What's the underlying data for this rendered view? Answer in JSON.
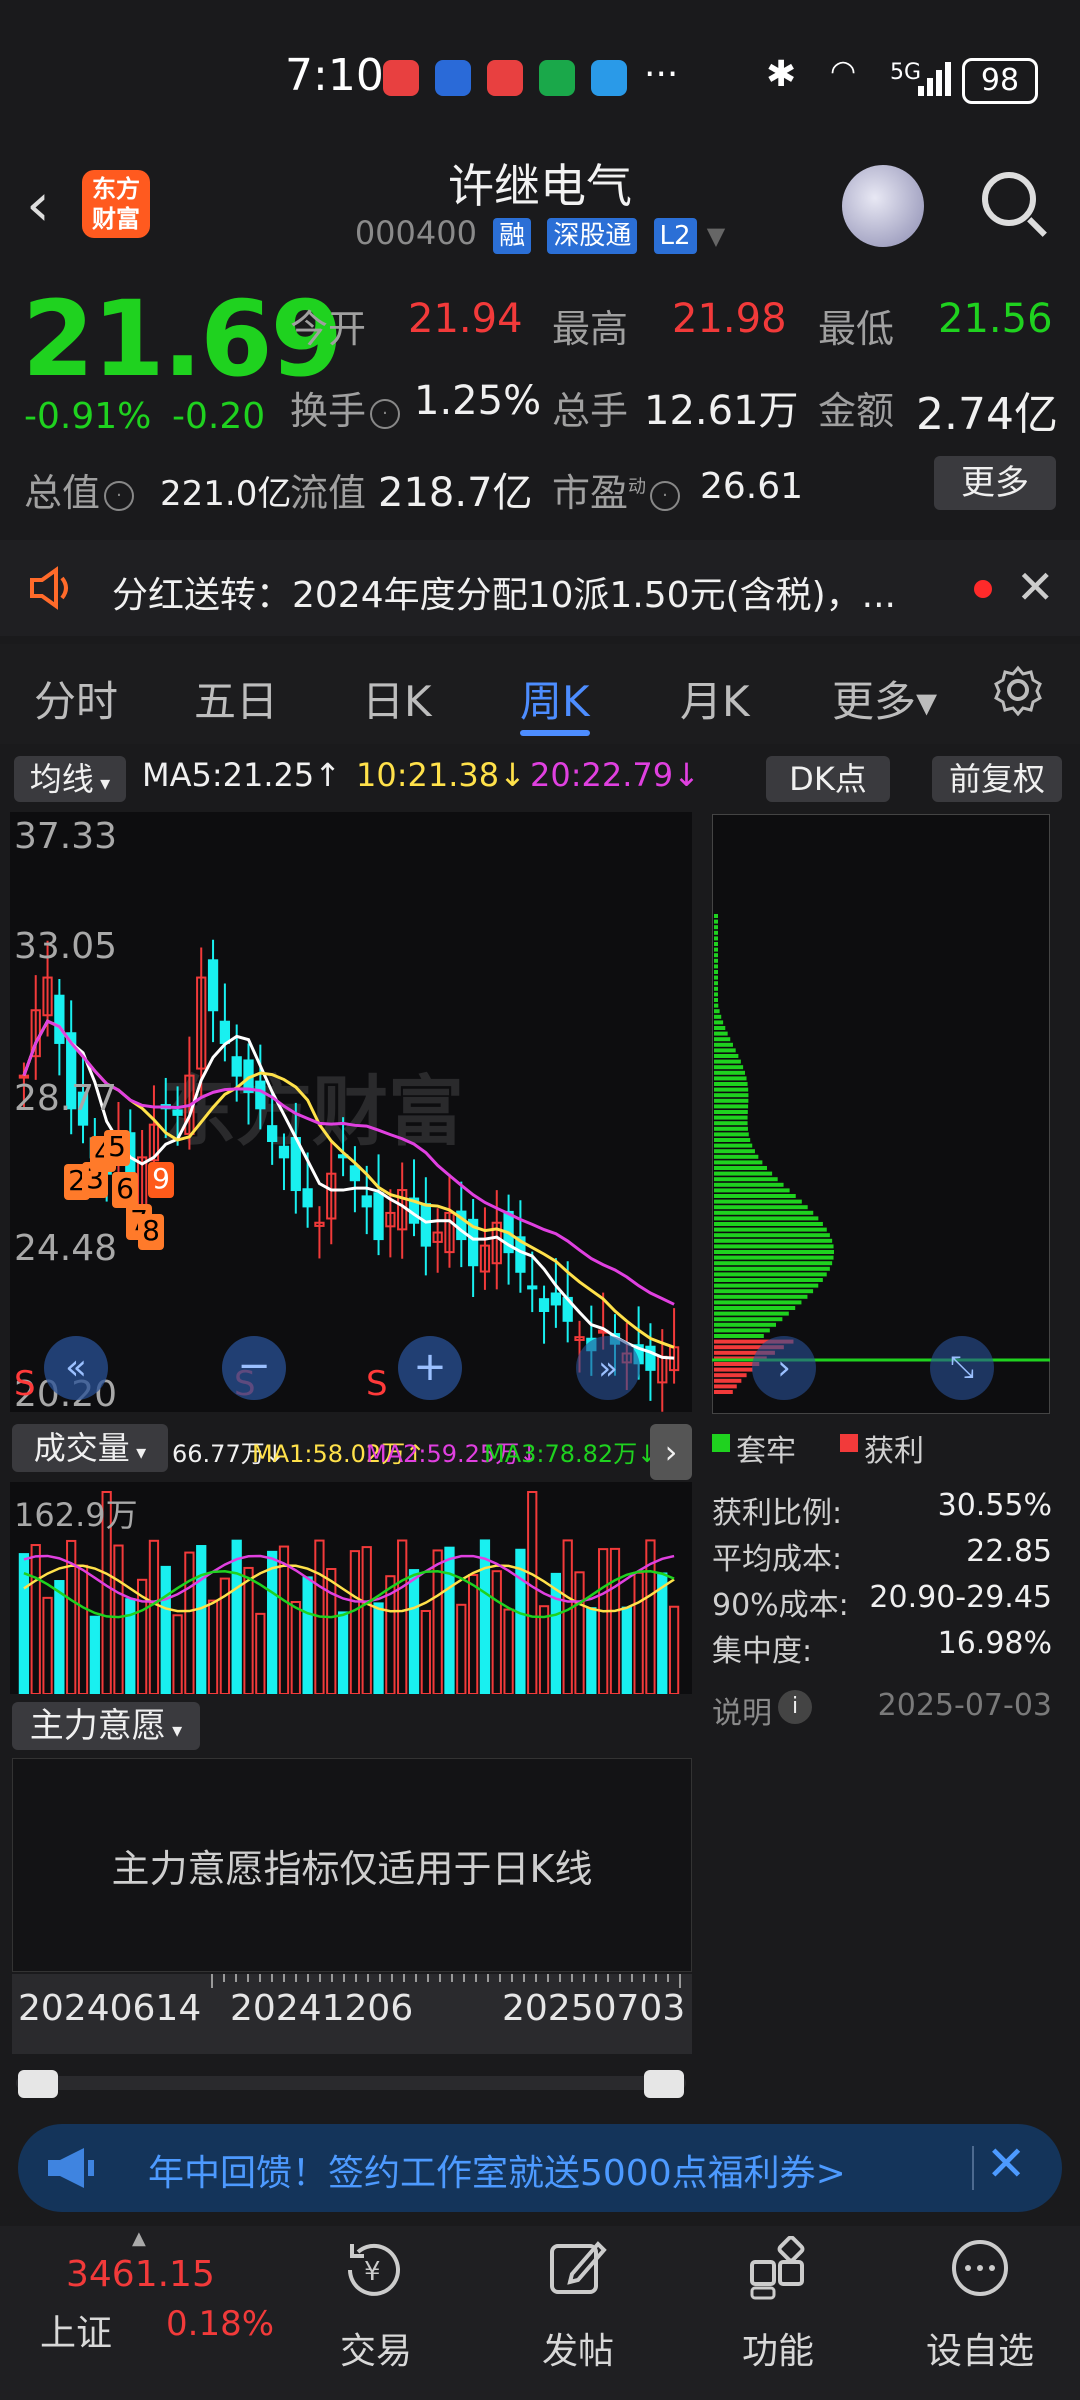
{
  "status_bar": {
    "time": "7:10",
    "battery": "98",
    "more": "···",
    "signal": "5G"
  },
  "header": {
    "back_label": "‹",
    "logo_text": "东方\n财富",
    "stock_name": "许继电气",
    "stock_code": "000400",
    "tags": [
      "融",
      "深股通",
      "L2"
    ]
  },
  "quote": {
    "price": "21.69",
    "change_pct": "-0.91%",
    "change": "-0.20",
    "open_label": "今开",
    "open": "21.94",
    "high_label": "最高",
    "high": "21.98",
    "low_label": "最低",
    "low": "21.56",
    "turnover_label": "换手",
    "turnover": "1.25%",
    "volume_label": "总手",
    "volume": "12.61万",
    "amount_label": "金额",
    "amount": "2.74亿",
    "mktcap_label": "总值",
    "mktcap": "221.0亿",
    "float_label": "流值",
    "float_cap": "218.7亿",
    "pe_label": "市盈",
    "pe_sup": "动",
    "pe": "26.61",
    "more_button": "更多"
  },
  "notice": {
    "text": "分红送转：2024年度分配10派1.50元(含税)，..."
  },
  "tabs": [
    {
      "label": "分时"
    },
    {
      "label": "五日"
    },
    {
      "label": "日K"
    },
    {
      "label": "周K"
    },
    {
      "label": "月K"
    },
    {
      "label": "更多▾"
    }
  ],
  "kline": {
    "indicator_label": "均线",
    "ma5": "MA5:21.25↑",
    "ma10": "10:21.38↓",
    "ma20": "20:22.79↓",
    "dk_button": "DK点",
    "adjust_button": "前复权",
    "y_ticks": [
      "37.33",
      "33.05",
      "28.77",
      "24.48",
      "20.20"
    ],
    "watermark": "东方财富",
    "markers": [
      "2",
      "3",
      "4",
      "5",
      "6",
      "7",
      "8",
      "9"
    ],
    "s_marks": [
      "S",
      "S",
      "S"
    ]
  },
  "volume": {
    "indicator_label": "成交量",
    "value": "66.77万↓",
    "ma1": "MA1:58.02万↑",
    "ma2": "MA2:59.25万↓",
    "ma3": "MA3:78.82万↓",
    "max_label": "162.9万"
  },
  "chip": {
    "legend_trapped": "套牢",
    "legend_profit": "获利",
    "rows": [
      {
        "label": "获利比例:",
        "value": "30.55%"
      },
      {
        "label": "平均成本:",
        "value": "22.85"
      },
      {
        "label": "90%成本:",
        "value": "20.90-29.45"
      },
      {
        "label": "集中度:",
        "value": "16.98%"
      }
    ],
    "note_label": "说明",
    "date": "2025-07-03"
  },
  "main_force": {
    "label": "主力意愿",
    "message": "主力意愿指标仅适用于日K线"
  },
  "date_axis": [
    "20240614",
    "20241206",
    "20250703"
  ],
  "banner": {
    "text": "年中回馈！签约工作室就送5000点福利券>"
  },
  "bottom_nav": {
    "index_value": "3461.15",
    "index_name": "上证",
    "index_change": "0.18%",
    "items": [
      {
        "label": "交易"
      },
      {
        "label": "发帖"
      },
      {
        "label": "功能"
      },
      {
        "label": "设自选"
      }
    ]
  },
  "colors": {
    "up": "#f23a3a",
    "down": "#1fd21f",
    "accent": "#4d8dff",
    "cyan": "#19f0f0",
    "ma5": "#ffffff",
    "ma10": "#ffe14a",
    "ma20": "#e040e0"
  }
}
